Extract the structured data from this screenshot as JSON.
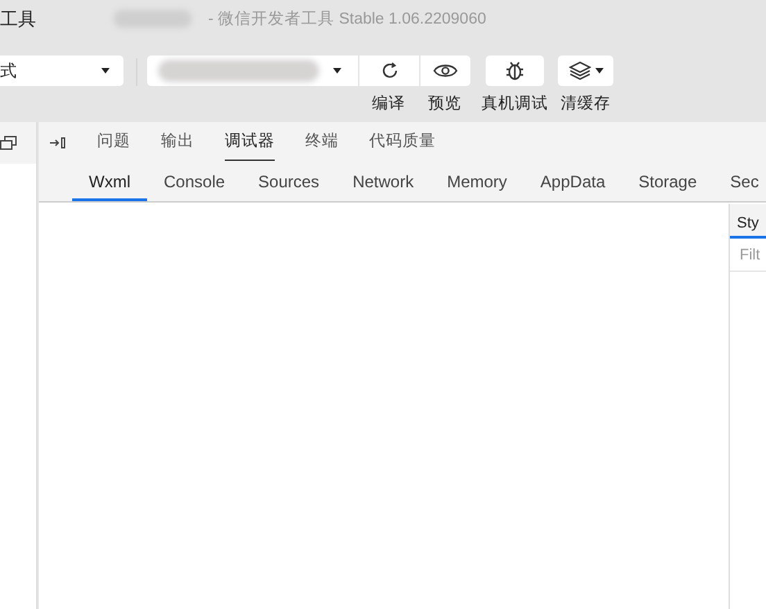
{
  "title_bar": {
    "app_name": "工具",
    "window_title": "- 微信开发者工具 Stable 1.06.2209060"
  },
  "toolbar": {
    "mode_select": {
      "value": "式"
    },
    "buttons": [
      {
        "kind": "refresh",
        "label": "编译"
      },
      {
        "kind": "eye",
        "label": "预览"
      },
      {
        "kind": "bug",
        "label": "真机调试"
      },
      {
        "kind": "layers",
        "label": "清缓存"
      }
    ]
  },
  "panel_tabs": [
    {
      "label": "问题",
      "selected": false
    },
    {
      "label": "输出",
      "selected": false
    },
    {
      "label": "调试器",
      "selected": true
    },
    {
      "label": "终端",
      "selected": false
    },
    {
      "label": "代码质量",
      "selected": false
    }
  ],
  "devtools_tabs": [
    {
      "label": "Wxml",
      "selected": true
    },
    {
      "label": "Console",
      "selected": false
    },
    {
      "label": "Sources",
      "selected": false
    },
    {
      "label": "Network",
      "selected": false
    },
    {
      "label": "Memory",
      "selected": false
    },
    {
      "label": "AppData",
      "selected": false
    },
    {
      "label": "Storage",
      "selected": false
    },
    {
      "label": "Sec",
      "selected": false
    }
  ],
  "side_pane": {
    "tab": "Sty",
    "filter": {
      "placeholder": "Filt"
    }
  }
}
